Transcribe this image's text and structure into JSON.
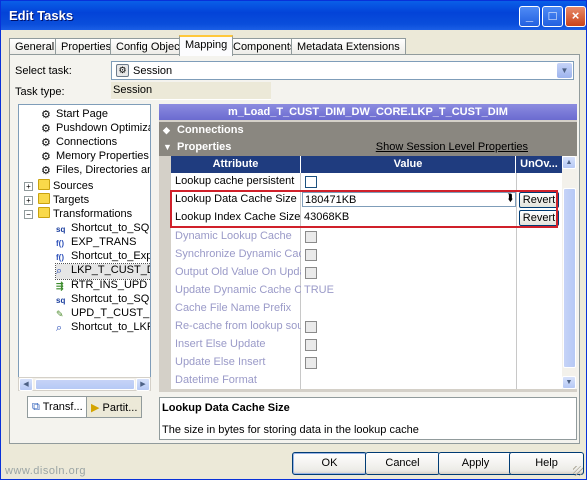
{
  "window": {
    "title": "Edit Tasks"
  },
  "tabs": [
    "General",
    "Properties",
    "Config Object",
    "Mapping",
    "Components",
    "Metadata Extensions"
  ],
  "active_tab": "Mapping",
  "select_task": {
    "label": "Select task:",
    "value": "Session"
  },
  "task_type": {
    "label": "Task type:",
    "value": "Session"
  },
  "tree": {
    "items": [
      {
        "label": "Start Page",
        "icon": "gear-icon"
      },
      {
        "label": "Pushdown Optimization",
        "icon": "gear-icon"
      },
      {
        "label": "Connections",
        "icon": "gear-icon"
      },
      {
        "label": "Memory Properties",
        "icon": "gear-icon"
      },
      {
        "label": "Files, Directories and Commands",
        "icon": "gear-icon"
      },
      {
        "label": "Sources",
        "icon": "folder-icon"
      },
      {
        "label": "Targets",
        "icon": "folder-icon"
      },
      {
        "label": "Transformations",
        "icon": "folder-icon"
      },
      {
        "label": "Shortcut_to_SQL_",
        "icon": "sql-icon"
      },
      {
        "label": "EXP_TRANS",
        "icon": "expression-icon"
      },
      {
        "label": "Shortcut_to_Exp_I",
        "icon": "expression-icon"
      },
      {
        "label": "LKP_T_CUST_DIM",
        "icon": "lookup-icon"
      },
      {
        "label": "RTR_INS_UPD",
        "icon": "router-icon"
      },
      {
        "label": "Shortcut_to_SQL_",
        "icon": "sql-icon"
      },
      {
        "label": "UPD_T_CUST_DIM",
        "icon": "update-icon"
      },
      {
        "label": "Shortcut_to_LKP_I",
        "icon": "lookup-icon"
      }
    ]
  },
  "bottom_tabs": [
    "Transf...",
    "Partit..."
  ],
  "mapping_name": "m_Load_T_CUST_DIM_DW_CORE.LKP_T_CUST_DIM",
  "sections": {
    "connections": "Connections",
    "properties": "Properties",
    "show_session_level": "Show Session Level Properties"
  },
  "grid": {
    "headers": {
      "attribute": "Attribute",
      "value": "Value",
      "override": "UnOv..."
    },
    "rows": [
      {
        "attribute": "Lookup cache persistent",
        "value": "",
        "kind": "checkbox",
        "enabled": true
      },
      {
        "attribute": "Lookup Data Cache Size",
        "value": "180471KB",
        "kind": "edit",
        "enabled": true,
        "revert": "Revert"
      },
      {
        "attribute": "Lookup Index Cache Size",
        "value": "43068KB",
        "kind": "edit",
        "enabled": true,
        "revert": "Revert"
      },
      {
        "attribute": "Dynamic Lookup Cache",
        "value": "",
        "kind": "checkbox",
        "enabled": false
      },
      {
        "attribute": "Synchronize Dynamic Cache",
        "value": "",
        "kind": "checkbox",
        "enabled": false
      },
      {
        "attribute": "Output Old Value On Update",
        "value": "",
        "kind": "checkbox",
        "enabled": false
      },
      {
        "attribute": "Update Dynamic Cache Co...",
        "value": "TRUE",
        "kind": "text",
        "enabled": false
      },
      {
        "attribute": "Cache File Name Prefix",
        "value": "",
        "kind": "text",
        "enabled": false
      },
      {
        "attribute": "Re-cache from lookup source",
        "value": "",
        "kind": "checkbox",
        "enabled": false
      },
      {
        "attribute": "Insert Else Update",
        "value": "",
        "kind": "checkbox",
        "enabled": false
      },
      {
        "attribute": "Update Else Insert",
        "value": "",
        "kind": "checkbox",
        "enabled": false
      },
      {
        "attribute": "Datetime Format",
        "value": "",
        "kind": "text",
        "enabled": false
      }
    ]
  },
  "description": {
    "title": "Lookup Data Cache Size",
    "text": "The size in bytes for storing data in the lookup cache"
  },
  "buttons": {
    "ok": "OK",
    "cancel": "Cancel",
    "apply": "Apply",
    "help": "Help"
  },
  "watermark": "www.disoln.org",
  "colors": {
    "title_bar": "#0343D8",
    "highlight_box": "#D0202A",
    "grid_header": "#1F3C7F",
    "mapping_banner": "#7B7BD8"
  }
}
